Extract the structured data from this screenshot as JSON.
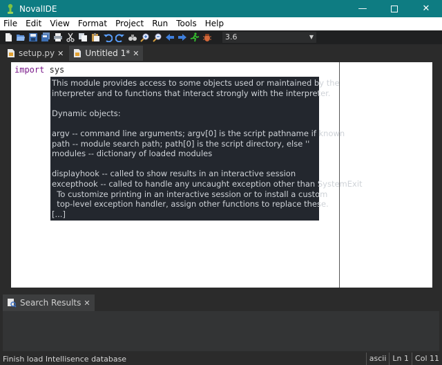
{
  "window": {
    "title": "NovalIDE"
  },
  "menu": [
    "File",
    "Edit",
    "View",
    "Format",
    "Project",
    "Run",
    "Tools",
    "Help"
  ],
  "toolbar": {
    "interpreter_version": "3.6"
  },
  "tabs": [
    {
      "label": "setup.py"
    },
    {
      "label": "Untitled 1*"
    }
  ],
  "editor": {
    "keyword": "import",
    "module": "sys"
  },
  "calltip": {
    "lines": [
      "This module provides access to some objects used or maintained by the",
      "interpreter and to functions that interact strongly with the interpreter.",
      "",
      "Dynamic objects:",
      "",
      "argv -- command line arguments; argv[0] is the script pathname if known",
      "path -- module search path; path[0] is the script directory, else ''",
      "modules -- dictionary of loaded modules",
      "",
      "displayhook -- called to show results in an interactive session",
      "excepthook -- called to handle any uncaught exception other than SystemExit",
      "  To customize printing in an interactive session or to install a custom",
      "  top-level exception handler, assign other functions to replace these.",
      "[...]"
    ]
  },
  "bottom_panel": {
    "tab_label": "Search Results"
  },
  "status": {
    "message": "Finish load Intellisence database",
    "encoding": "ascii",
    "line": "Ln 1",
    "column": "Col 11"
  },
  "colors": {
    "titlebar": "#0e7c82",
    "editor_bg": "#ffffff",
    "calltip_bg": "#23272e",
    "keyword": "#7a1a8a"
  }
}
